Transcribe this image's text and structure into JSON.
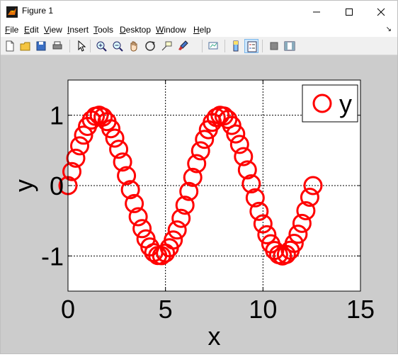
{
  "window": {
    "title": "Figure 1"
  },
  "menu": [
    {
      "pre": "",
      "u": "F",
      "post": "ile"
    },
    {
      "pre": "",
      "u": "E",
      "post": "dit"
    },
    {
      "pre": "",
      "u": "V",
      "post": "iew"
    },
    {
      "pre": "",
      "u": "I",
      "post": "nsert"
    },
    {
      "pre": "",
      "u": "T",
      "post": "ools"
    },
    {
      "pre": "",
      "u": "D",
      "post": "esktop"
    },
    {
      "pre": "",
      "u": "W",
      "post": "indow"
    },
    {
      "pre": "",
      "u": "H",
      "post": "elp"
    }
  ],
  "toolbar": [
    "new-figure-icon",
    "open-file-icon",
    "save-icon",
    "print-icon",
    "pointer-icon",
    "zoom-in-icon",
    "zoom-out-icon",
    "pan-hand-icon",
    "rotate-3d-icon",
    "data-cursor-icon",
    "brush-icon",
    "link-plot-icon",
    "colorbar-icon",
    "legend-icon",
    "hide-plot-tools-icon",
    "show-plot-tools-icon"
  ],
  "chart_data": {
    "type": "scatter",
    "xlabel": "x",
    "ylabel": "y",
    "xlim": [
      0,
      15
    ],
    "ylim": [
      -1.5,
      1.5
    ],
    "xticks": [
      "0",
      "5",
      "10",
      "15"
    ],
    "yticks": [
      "1",
      "0",
      "-1"
    ],
    "grid": true,
    "legend": {
      "entries": [
        "y"
      ],
      "position": "top-right"
    },
    "marker": "circle",
    "color": "#ff0000",
    "series": [
      {
        "name": "y",
        "x": [
          0,
          0.2,
          0.4,
          0.6,
          0.8,
          1,
          1.2,
          1.4,
          1.6,
          1.8,
          2,
          2.2,
          2.4,
          2.6,
          2.8,
          3,
          3.2,
          3.4,
          3.6,
          3.8,
          4,
          4.2,
          4.4,
          4.6,
          4.8,
          5,
          5.2,
          5.4,
          5.6,
          5.8,
          6,
          6.2,
          6.4,
          6.6,
          6.8,
          7,
          7.2,
          7.4,
          7.6,
          7.8,
          8,
          8.2,
          8.4,
          8.6,
          8.8,
          9,
          9.2,
          9.4,
          9.6,
          9.8,
          10,
          10.2,
          10.4,
          10.6,
          10.8,
          11,
          11.2,
          11.4,
          11.6,
          11.8,
          12,
          12.2,
          12.4,
          12.566
        ],
        "y": [
          0,
          0.199,
          0.389,
          0.565,
          0.717,
          0.841,
          0.932,
          0.985,
          1.0,
          0.974,
          0.909,
          0.808,
          0.675,
          0.516,
          0.335,
          0.141,
          -0.058,
          -0.256,
          -0.443,
          -0.612,
          -0.757,
          -0.872,
          -0.952,
          -0.994,
          -0.996,
          -0.959,
          -0.883,
          -0.773,
          -0.631,
          -0.465,
          -0.279,
          -0.083,
          0.117,
          0.312,
          0.494,
          0.657,
          0.794,
          0.899,
          0.968,
          0.999,
          0.989,
          0.941,
          0.855,
          0.734,
          0.585,
          0.412,
          0.223,
          0.025,
          -0.174,
          -0.366,
          -0.544,
          -0.699,
          -0.827,
          -0.922,
          -0.981,
          -1.0,
          -0.979,
          -0.918,
          -0.821,
          -0.691,
          -0.537,
          -0.357,
          -0.166,
          0.0
        ]
      }
    ]
  }
}
